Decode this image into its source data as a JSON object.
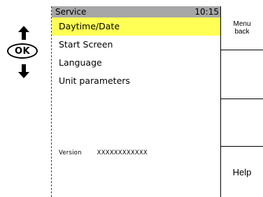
{
  "screen": {
    "title": "Service",
    "time": "10:15",
    "menu": [
      {
        "label": "Daytime/Date",
        "selected": true
      },
      {
        "label": "Start Screen",
        "selected": false
      },
      {
        "label": "Language",
        "selected": false
      },
      {
        "label": "Unit  parameters",
        "selected": false
      }
    ],
    "version_label": "Version",
    "version_value": "XXXXXXXXXXXX"
  },
  "nav": {
    "ok_label": "OK",
    "up_icon": "arrow-up-icon",
    "down_icon": "arrow-down-icon"
  },
  "softkeys": {
    "key1_line1": "Menu",
    "key1_line2": "back",
    "key4_label": "Help"
  },
  "colors": {
    "title_bar": "#a6a6a6",
    "selection": "#ffff55"
  }
}
